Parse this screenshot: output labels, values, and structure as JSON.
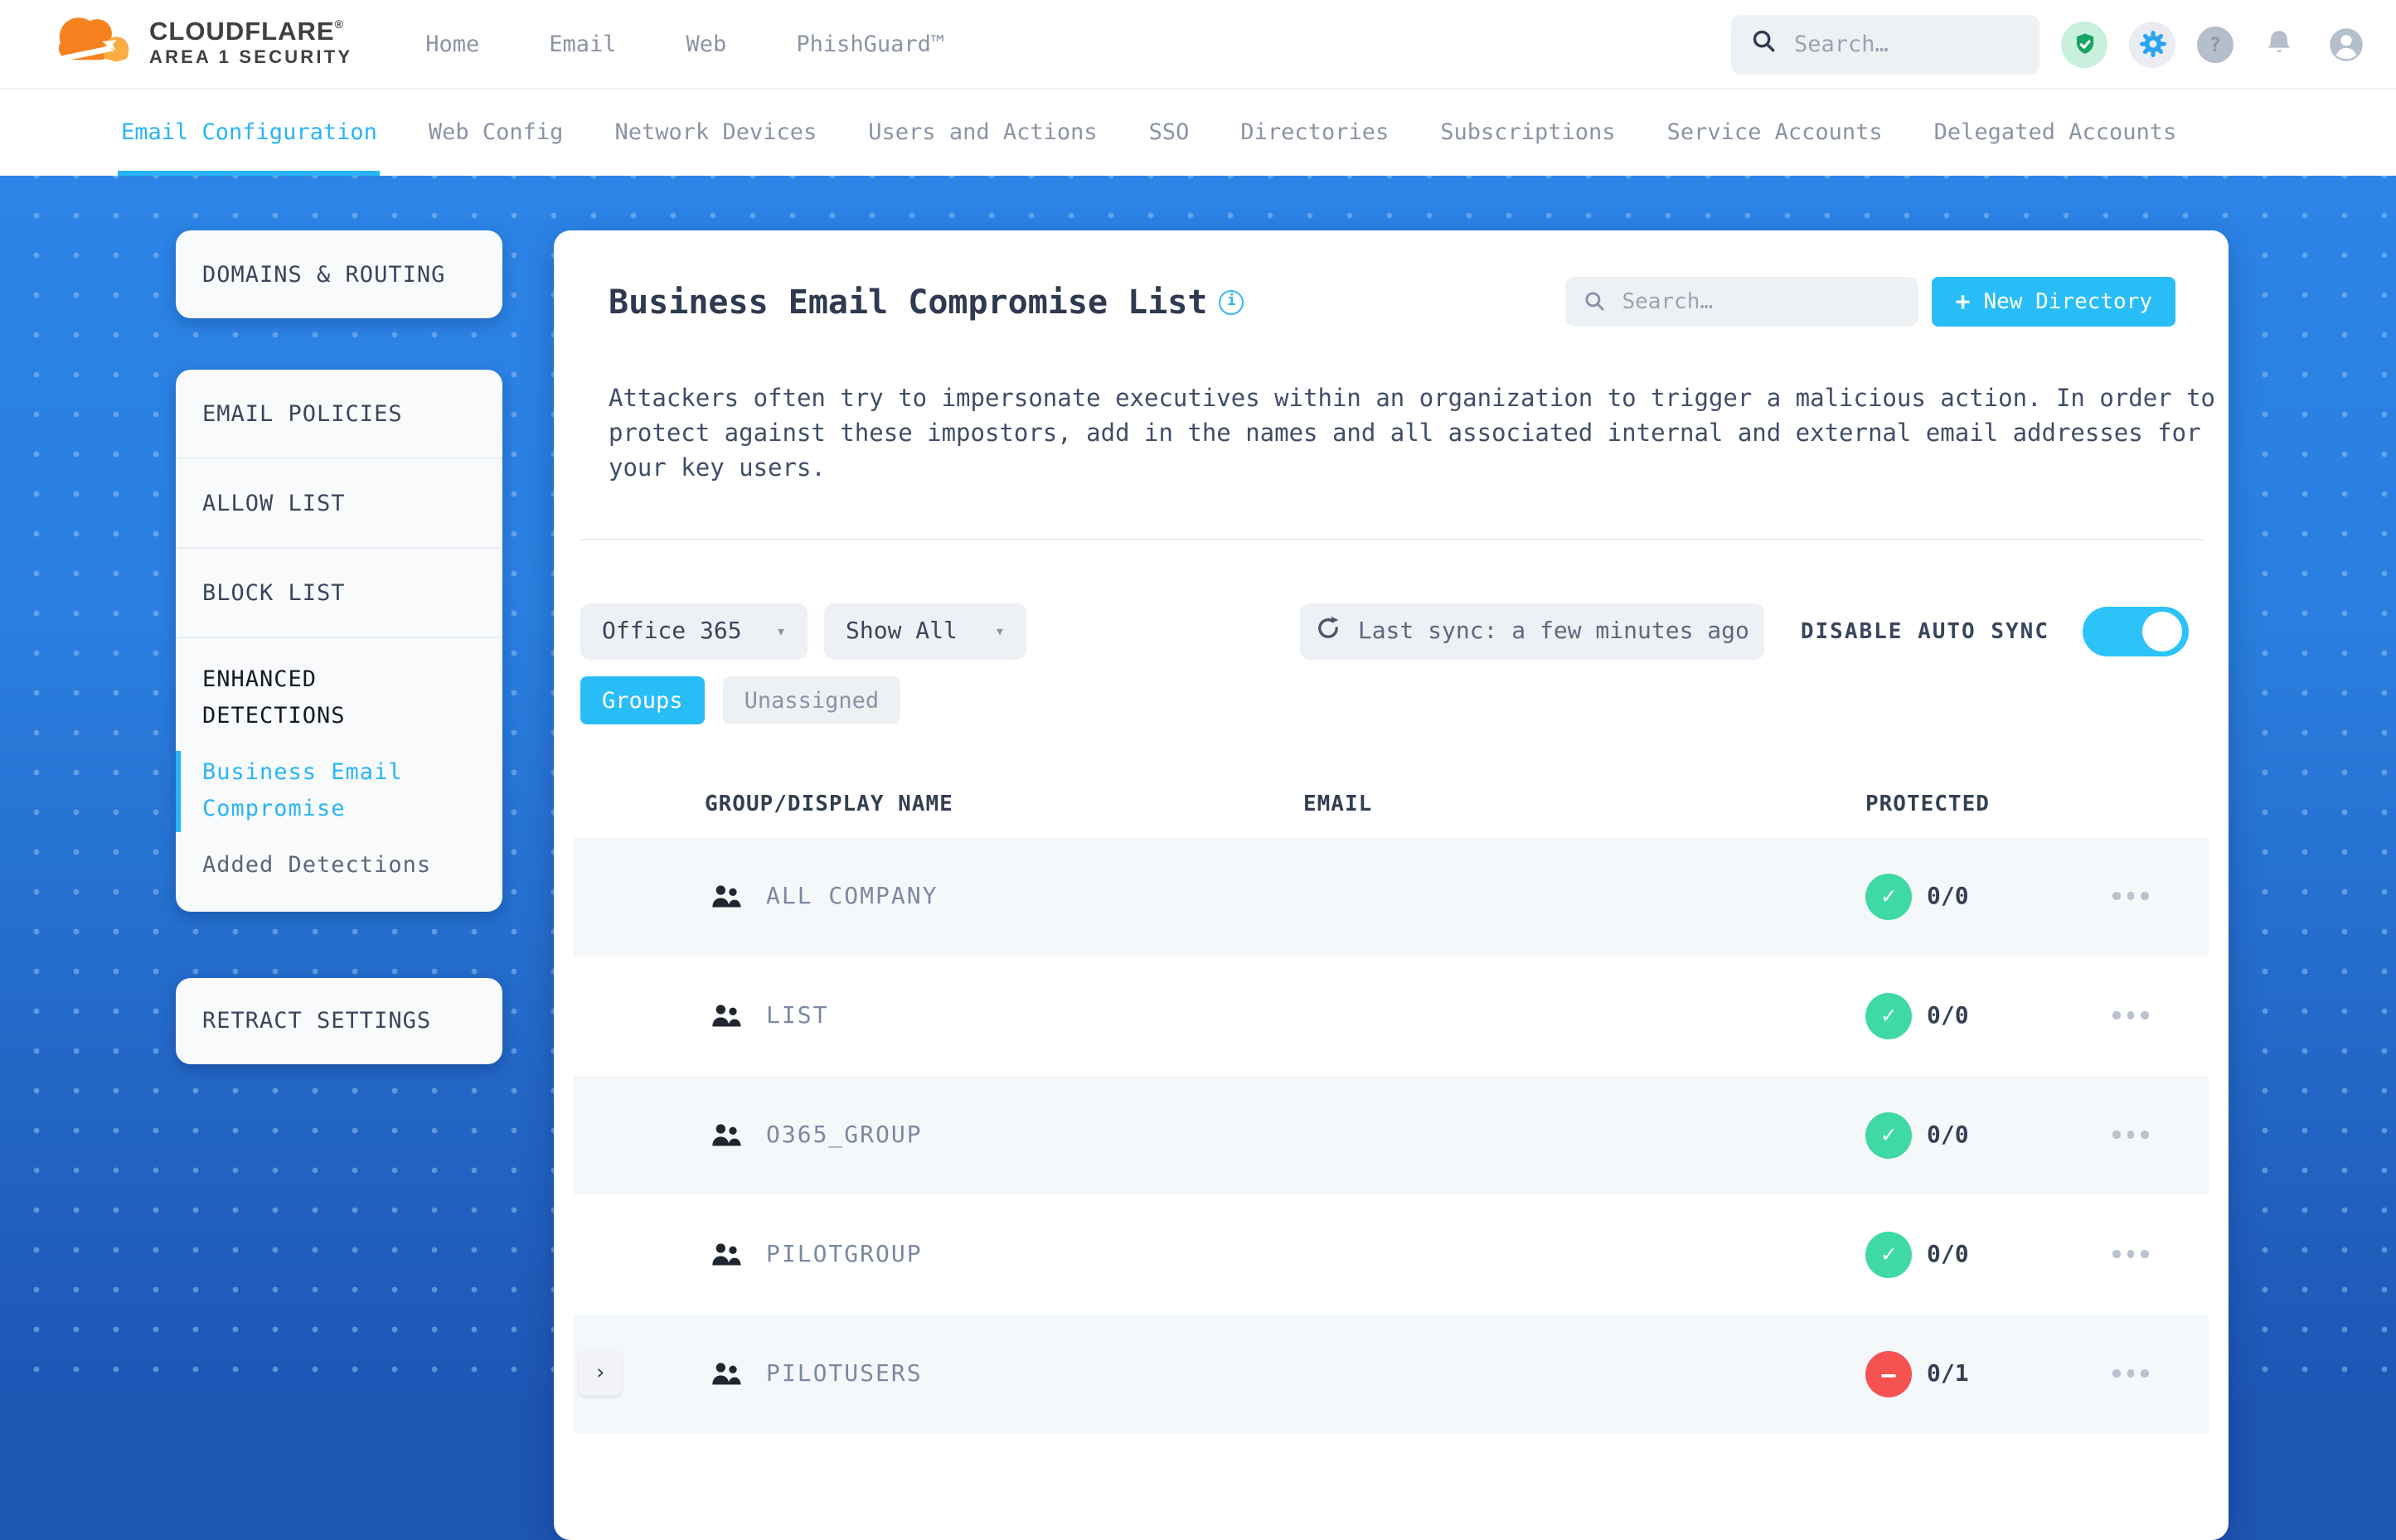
{
  "brand": {
    "line1": "CLOUDFLARE",
    "mark": "®",
    "line2": "AREA 1 SECURITY"
  },
  "header": {
    "nav": [
      "Home",
      "Email",
      "Web",
      "PhishGuard™"
    ],
    "search_placeholder": "Search…",
    "icons": [
      "shield-check-icon",
      "gear-icon",
      "help-icon",
      "bell-icon",
      "account-icon"
    ]
  },
  "tabs": {
    "items": [
      "Email Configuration",
      "Web Config",
      "Network Devices",
      "Users and Actions",
      "SSO",
      "Directories",
      "Subscriptions",
      "Service Accounts",
      "Delegated Accounts"
    ],
    "active": "Email Configuration"
  },
  "sidebar": {
    "card1": "DOMAINS & ROUTING",
    "card2": [
      "EMAIL POLICIES",
      "ALLOW LIST",
      "BLOCK LIST"
    ],
    "enhanced_title": "ENHANCED DETECTIONS",
    "enhanced_active": "Business Email Compromise",
    "enhanced_item": "Added Detections",
    "card3": "RETRACT SETTINGS"
  },
  "icons": {
    "info": "i",
    "question": "?",
    "caret": "▾",
    "plus": "+"
  },
  "main": {
    "title": "Business Email Compromise List",
    "search_placeholder": "Search…",
    "new_directory": "New Directory",
    "description": "Attackers often try to impersonate executives within an organization to trigger a malicious action. In order to protect against these impostors, add in the names and all associated internal and external email addresses for your key users.",
    "directory_filter": "Office 365",
    "show_filter": "Show All",
    "last_sync": "Last sync: a few minutes ago",
    "auto_sync_label": "DISABLE AUTO SYNC",
    "auto_sync_enabled": true,
    "chips": [
      "Groups",
      "Unassigned"
    ],
    "active_chip": "Groups",
    "table": {
      "headers": [
        "GROUP/DISPLAY NAME",
        "EMAIL",
        "PROTECTED"
      ],
      "rows": [
        {
          "name": "ALL COMPANY",
          "email": "",
          "protected": "0/0",
          "status": "ok",
          "status_glyph": "✓"
        },
        {
          "name": "LIST",
          "email": "",
          "protected": "0/0",
          "status": "ok",
          "status_glyph": "✓"
        },
        {
          "name": "O365_GROUP",
          "email": "",
          "protected": "0/0",
          "status": "ok",
          "status_glyph": "✓"
        },
        {
          "name": "PILOTGROUP",
          "email": "",
          "protected": "0/0",
          "status": "ok",
          "status_glyph": "✓"
        },
        {
          "name": "PILOTUSERS",
          "email": "",
          "protected": "0/1",
          "status": "blocked",
          "status_glyph": "−",
          "expander": "›",
          "expandable": true
        }
      ]
    }
  },
  "colors": {
    "accent": "#28bdf7",
    "active_tab": "#29b5f5",
    "ok": "#3fd9a4",
    "blocked": "#f45352",
    "canvas_top": "#2b84e6",
    "canvas_bottom": "#1e56b4"
  }
}
